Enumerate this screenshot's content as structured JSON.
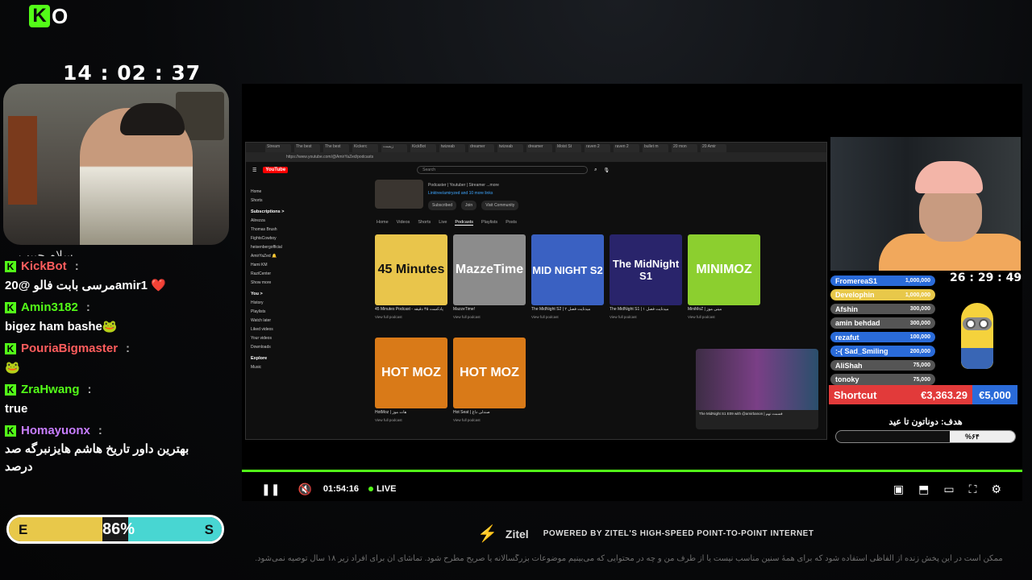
{
  "brand": {
    "k": "K",
    "o": "O"
  },
  "clock": "14 : 02 : 37",
  "chat": {
    "cutoff_text": "سلام حبیب ...",
    "messages": [
      {
        "user": "KickBot",
        "color": "#ff5d5d",
        "text": "مرسی بابت فالو @20amir1 ❤️"
      },
      {
        "user": "Amin3182",
        "color": "#53fc18",
        "text": "bigez ham bashe🐸"
      },
      {
        "user": "PouriaBigmaster",
        "color": "#ff5d5d",
        "text": "🐸"
      },
      {
        "user": "ZraHwang",
        "color": "#53fc18",
        "text": "true"
      },
      {
        "user": "Homayuonx",
        "color": "#c77dff",
        "text": "بهترین داور تاریخ هاشم هایزنبرگه صد درصد"
      }
    ],
    "colon": ":"
  },
  "energy_meter": {
    "left": "E",
    "right": "S",
    "percent_text": "86%",
    "value": 0.86
  },
  "player": {
    "time": "01:54:16",
    "live_label": "LIVE",
    "icons": [
      "pause-icon",
      "mute-icon",
      "miniplayer-icon",
      "theater-icon",
      "cast-icon",
      "fullscreen-icon",
      "settings-icon"
    ]
  },
  "browser": {
    "tabs": [
      "Stream",
      "The best",
      "The best",
      "Kickerc",
      "زیست",
      "KickBot",
      "twizeab",
      "dreamer",
      "twizeab",
      "dreamer",
      "Moist St",
      "raven 2",
      "raven 2",
      "bullet m",
      "20 mon",
      "20 Amir"
    ],
    "url": "https://www.youtube.com/@AmirYaZed/podcasts",
    "search_placeholder": "Search",
    "logo": "YouTube",
    "side": {
      "main": [
        "Home",
        "Shorts"
      ],
      "subs_title": "Subscriptions >",
      "subs": [
        "Alirezza",
        "Thomas Brush",
        "FightsCowboy",
        "heisenbergofficial",
        "AmirYaZed 🔔",
        "Hami KM",
        "RaziCenter",
        "Show more"
      ],
      "you_title": "You >",
      "you": [
        "History",
        "Playlists",
        "Watch later",
        "Liked videos",
        "Your videos",
        "Downloads"
      ],
      "explore_title": "Explore",
      "explore": [
        "Music"
      ]
    },
    "channel": {
      "desc": "Podcaster | Youtuber | Streamer ...more",
      "links": "Linktree/amiryzed and 10 more links",
      "subscribed": "Subscribed",
      "join": "Join",
      "visit": "Visit Community"
    },
    "tabs_yt": [
      "Home",
      "Videos",
      "Shorts",
      "Live",
      "Podcasts",
      "Playlists",
      "Posts"
    ],
    "active_tab": "Podcasts",
    "cards": [
      {
        "thumb": "45 Minutes",
        "title": "45 Minutes Podcast - پادکست ۴۵ دقیقه",
        "sub": "View full podcast",
        "color": "#e9c54b"
      },
      {
        "thumb": "MazzeTime",
        "title": "MazzeTime!",
        "sub": "View full podcast",
        "color": "#8c8c8c"
      },
      {
        "thumb": "MID NIGHT S2",
        "title": "The MidNight S2 | میدنایت فصل ۲",
        "sub": "View full podcast",
        "color": "#3a61c2"
      },
      {
        "thumb": "The MidNight S1",
        "title": "The MidNight S1 | میدنایت فصل ۱",
        "sub": "View full podcast",
        "color": "#29246b"
      },
      {
        "thumb": "MINIMOZ",
        "title": "MiniMoZ | مینی موز",
        "sub": "View full podcast",
        "color": "#8ccf2f"
      },
      {
        "thumb": "HOT MOZ",
        "title": "HotMoz | هات موز",
        "sub": "View full podcast",
        "color": "#d97a18"
      },
      {
        "thumb": "HOT MOZ",
        "title": "Hot Seat | صندلی داغ",
        "sub": "View full podcast",
        "color": "#d97a18"
      }
    ],
    "mini_video": "The MidNight S1 E09 with @amirbanon | قسمت نهم"
  },
  "leaderboard": [
    {
      "name": "FromereaS1",
      "amount": "1,000,000",
      "color": "#2a6bd9"
    },
    {
      "name": "Develophin",
      "amount": "1,000,000",
      "color": "#e8c84a"
    },
    {
      "name": "Afshin",
      "amount": "300,000",
      "color": "#555555"
    },
    {
      "name": "amin behdad",
      "amount": "300,000",
      "color": "#555555"
    },
    {
      "name": "rezafut",
      "amount": "100,000",
      "color": "#2a6bd9"
    },
    {
      "name": ":-( Sad_Smiling",
      "amount": "200,000",
      "color": "#2a6bd9"
    },
    {
      "name": "AliShah",
      "amount": "75,000",
      "color": "#555555"
    },
    {
      "name": "tonoky",
      "amount": "75,000",
      "color": "#555555"
    }
  ],
  "countdown": "26 : 29 : 49",
  "shortcut": {
    "label": "Shortcut",
    "amount": "€3,363.29",
    "goal": "€5,000"
  },
  "goal": {
    "text": "هدف: دوناتون تا عید",
    "percent": "%۶۴",
    "value": 0.64
  },
  "sponsor": {
    "name": "Zitel",
    "tagline": "POWERED BY ZITEL'S HIGH-SPEED POINT-TO-POINT INTERNET"
  },
  "disclaimer": "ممکن است در این پخش زنده از الفاظی استفاده شود که برای همهٔ سنین مناسب نیست یا از طرف من و چه در محتوایی که می‌بینیم موضوعات بزرگسالانه یا صریح مطرح شود. تماشای آن برای افراد زیر ۱۸ سال توصیه نمی‌شود."
}
